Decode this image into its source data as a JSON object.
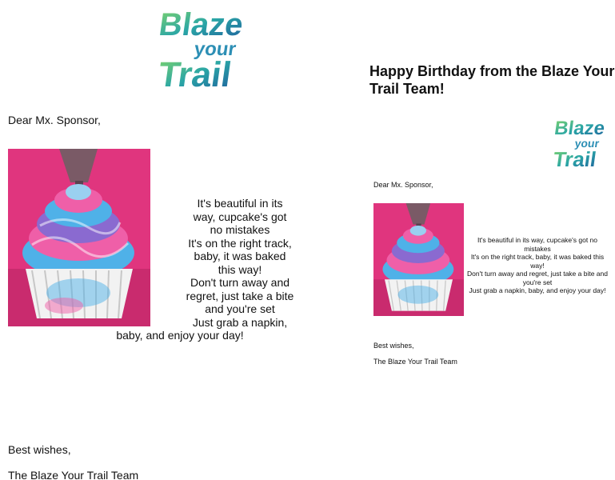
{
  "logo": {
    "line1": "Blaze",
    "line2": "your",
    "line3": "Trail"
  },
  "email": {
    "greeting": "Dear Mx. Sponsor,",
    "poem_large": [
      "It's beautiful in its",
      "way, cupcake's got",
      "no mistakes",
      "It's on the right track,",
      "baby, it was baked",
      "this way!",
      "Don't turn away and",
      "regret, just take a bite",
      "and you're set",
      "Just grab a napkin,",
      "baby, and enjoy your day!"
    ],
    "closing": "Best wishes,",
    "signature": "The Blaze Your Trail Team"
  },
  "preview": {
    "heading": "Happy Birthday from the Blaze Your Trail Team!",
    "greeting": "Dear Mx. Sponsor,",
    "poem_small": [
      "It's beautiful in its way, cupcake's got no mistakes",
      "It's on the right track, baby, it was baked this way!",
      "Don't turn away and regret, just take a bite and",
      "you're set",
      "Just grab a napkin, baby, and enjoy your day!"
    ],
    "closing": "Best wishes,",
    "signature": "The Blaze Your Trail Team"
  },
  "colors": {
    "logo_teal": "#2aa6a6",
    "logo_blue": "#1f5f9e",
    "logo_lime": "#8fd36a",
    "cupcake_background": "#e0357e",
    "frosting_pink": "#ef5fa8",
    "frosting_blue": "#4fb1e8",
    "frosting_purple": "#8a6ad0"
  }
}
